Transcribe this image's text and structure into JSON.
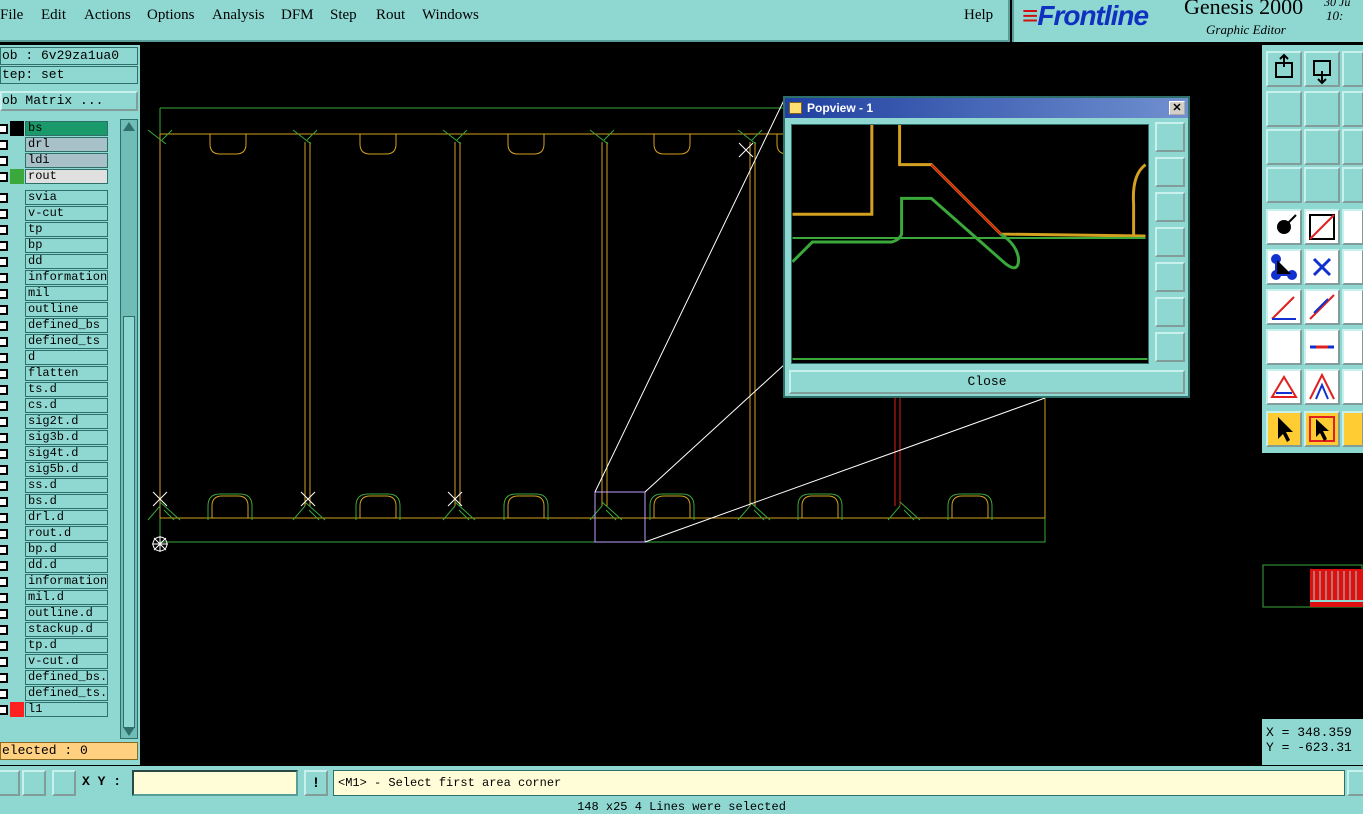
{
  "menu": {
    "items": [
      "File",
      "Edit",
      "Actions",
      "Options",
      "Analysis",
      "DFM",
      "Step",
      "Rout",
      "Windows"
    ],
    "help": "Help"
  },
  "brand": {
    "logo": "Frontline",
    "product": "Genesis 2000",
    "subtitle": "Graphic Editor",
    "clock_line1": "30 Ju",
    "clock_line2": "10:"
  },
  "left": {
    "job": "ob : 6v29za1ua0",
    "step": "tep: set",
    "job_matrix": "ob Matrix ...",
    "layers": [
      {
        "name": "bs",
        "color": "#1a9a6a",
        "highlight": true
      },
      {
        "name": "drl",
        "color": "#8fd8d2"
      },
      {
        "name": "ldi",
        "color": "#8fd8d2"
      },
      {
        "name": "rout",
        "color": "#3aa83a"
      },
      {
        "name": "svia"
      },
      {
        "name": "v-cut"
      },
      {
        "name": "tp"
      },
      {
        "name": "bp"
      },
      {
        "name": "dd"
      },
      {
        "name": "information"
      },
      {
        "name": "mil"
      },
      {
        "name": "outline"
      },
      {
        "name": "defined_bs"
      },
      {
        "name": "defined_ts"
      },
      {
        "name": "d"
      },
      {
        "name": "flatten"
      },
      {
        "name": "ts.d"
      },
      {
        "name": "cs.d"
      },
      {
        "name": "sig2t.d"
      },
      {
        "name": "sig3b.d"
      },
      {
        "name": "sig4t.d"
      },
      {
        "name": "sig5b.d"
      },
      {
        "name": "ss.d"
      },
      {
        "name": "bs.d"
      },
      {
        "name": "drl.d"
      },
      {
        "name": "rout.d"
      },
      {
        "name": "bp.d"
      },
      {
        "name": "dd.d"
      },
      {
        "name": "information"
      },
      {
        "name": "mil.d"
      },
      {
        "name": "outline.d"
      },
      {
        "name": "stackup.d"
      },
      {
        "name": "tp.d"
      },
      {
        "name": "v-cut.d"
      },
      {
        "name": "defined_bs.d"
      },
      {
        "name": "defined_ts.d"
      },
      {
        "name": "l1",
        "color": "#ff2020"
      }
    ],
    "selected": "elected : 0"
  },
  "bottom": {
    "xy_label": "X Y :",
    "xy_value": "",
    "message": "<M1> - Select first area corner",
    "status": "148 x25 4 Lines were selected"
  },
  "coords": {
    "x": "X = 348.359",
    "y": "Y = -623.31"
  },
  "popview": {
    "title": "Popview - 1",
    "close_label": "Close"
  },
  "colors": {
    "panel": "#8fd8d2",
    "gold": "#d4a020",
    "green": "#3aa83a",
    "red": "#d82010"
  }
}
